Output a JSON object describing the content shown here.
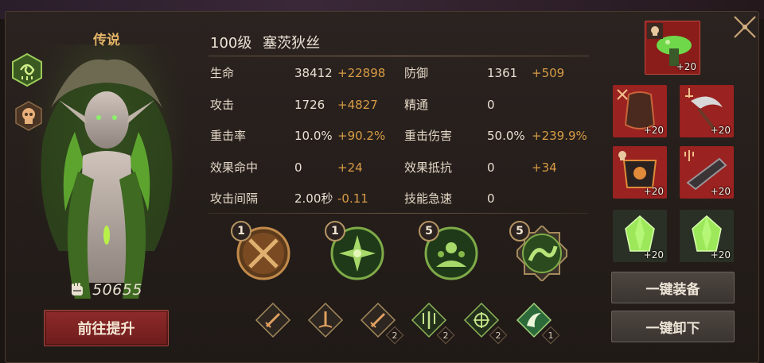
{
  "hero": {
    "rarity": "传说",
    "level": "100级",
    "name": "塞茨狄丝",
    "power": "50655"
  },
  "buttons": {
    "upgrade": "前往提升",
    "equip_all": "一键装备",
    "unequip_all": "一键卸下"
  },
  "stats": [
    {
      "name": "生命",
      "base": "38412",
      "bonus": "+22898"
    },
    {
      "name": "防御",
      "base": "1361",
      "bonus": "+509"
    },
    {
      "name": "攻击",
      "base": "1726",
      "bonus": "+4827"
    },
    {
      "name": "精通",
      "base": "0",
      "bonus": ""
    },
    {
      "name": "重击率",
      "base": "10.0%",
      "bonus": "+90.2%"
    },
    {
      "name": "重击伤害",
      "base": "50.0%",
      "bonus": "+239.9%"
    },
    {
      "name": "效果命中",
      "base": "0",
      "bonus": "+24"
    },
    {
      "name": "效果抵抗",
      "base": "0",
      "bonus": "+34"
    },
    {
      "name": "攻击间隔",
      "base": "2.00秒",
      "bonus": "-0.11"
    },
    {
      "name": "技能急速",
      "base": "0",
      "bonus": ""
    }
  ],
  "skills": [
    {
      "level": "1",
      "icon": "crossed-swords-icon"
    },
    {
      "level": "1",
      "icon": "leaf-star-icon"
    },
    {
      "level": "5",
      "icon": "rising-army-icon"
    },
    {
      "level": "5",
      "icon": "serpent-icon"
    }
  ],
  "runes": [
    {
      "icon": "sword-rune-icon",
      "count": ""
    },
    {
      "icon": "blade-down-rune-icon",
      "count": ""
    },
    {
      "icon": "sword-rune-icon",
      "count": "2"
    },
    {
      "icon": "trident-rune-icon",
      "count": "2"
    },
    {
      "icon": "crosshair-rune-icon",
      "count": "2"
    },
    {
      "icon": "scythe-rune-icon",
      "count": "1"
    }
  ],
  "equipment": [
    {
      "slot": "accessory",
      "level": "+20",
      "icon": "mushroom-icon"
    },
    {
      "slot": "armor",
      "level": "+20",
      "icon": "chest-armor-icon"
    },
    {
      "slot": "weapon",
      "level": "+20",
      "icon": "scythe-weapon-icon"
    },
    {
      "slot": "armor",
      "level": "+20",
      "icon": "pauldron-icon"
    },
    {
      "slot": "weapon",
      "level": "+20",
      "icon": "gauntlet-icon"
    },
    {
      "slot": "gem",
      "level": "+20",
      "icon": "green-crystal-icon"
    },
    {
      "slot": "gem",
      "level": "+20",
      "icon": "green-crystal-icon"
    }
  ],
  "colors": {
    "accent_gold": "#d79c45",
    "upgrade_red": "#8e2a2a",
    "equip_red": "#b22a22",
    "nature_green": "#5fa83a"
  }
}
